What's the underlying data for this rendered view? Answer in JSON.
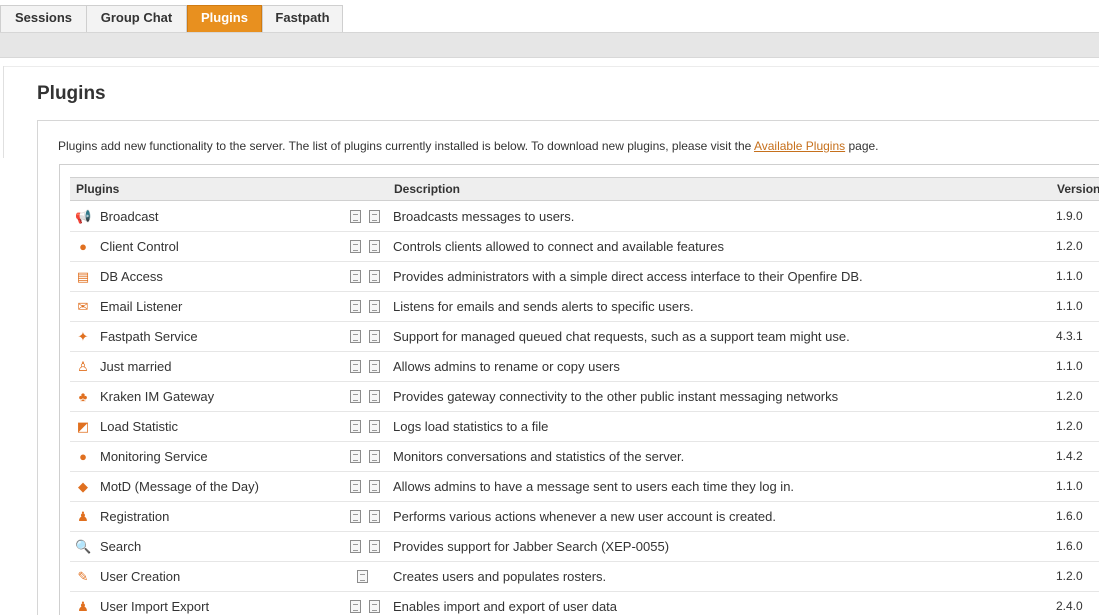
{
  "tabs": [
    {
      "label": "Sessions",
      "active": false
    },
    {
      "label": "Group Chat",
      "active": false
    },
    {
      "label": "Plugins",
      "active": true
    },
    {
      "label": "Fastpath",
      "active": false
    }
  ],
  "page": {
    "title": "Plugins",
    "intro_before": "Plugins add new functionality to the server. The list of plugins currently installed is below. To download new plugins, please visit the ",
    "intro_link": "Available Plugins",
    "intro_after": " page."
  },
  "table": {
    "headers": {
      "plugins": "Plugins",
      "description": "Description",
      "version": "Version"
    },
    "rows": [
      {
        "name": "Broadcast",
        "icon": "megaphone-icon",
        "glyph": "📢",
        "description": "Broadcasts messages to users.",
        "version": "1.9.0",
        "docs": 2
      },
      {
        "name": "Client Control",
        "icon": "client-control-icon",
        "glyph": "●",
        "description": "Controls clients allowed to connect and available features",
        "version": "1.2.0",
        "docs": 2
      },
      {
        "name": "DB Access",
        "icon": "database-window-icon",
        "glyph": "▤",
        "description": "Provides administrators with a simple direct access interface to their Openfire DB.",
        "version": "1.1.0",
        "docs": 2
      },
      {
        "name": "Email Listener",
        "icon": "email-icon",
        "glyph": "✉",
        "description": "Listens for emails and sends alerts to specific users.",
        "version": "1.1.0",
        "docs": 2
      },
      {
        "name": "Fastpath Service",
        "icon": "fastpath-flame-icon",
        "glyph": "✦",
        "description": "Support for managed queued chat requests, such as a support team might use.",
        "version": "4.3.1",
        "docs": 2
      },
      {
        "name": "Just married",
        "icon": "couple-icon",
        "glyph": "♙",
        "description": "Allows admins to rename or copy users",
        "version": "1.1.0",
        "docs": 2
      },
      {
        "name": "Kraken IM Gateway",
        "icon": "kraken-icon",
        "glyph": "♣",
        "description": "Provides gateway connectivity to the other public instant messaging networks",
        "version": "1.2.0",
        "docs": 2
      },
      {
        "name": "Load Statistic",
        "icon": "chart-icon",
        "glyph": "◩",
        "description": "Logs load statistics to a file",
        "version": "1.2.0",
        "docs": 2
      },
      {
        "name": "Monitoring Service",
        "icon": "monitoring-icon",
        "glyph": "●",
        "description": "Monitors conversations and statistics of the server.",
        "version": "1.4.2",
        "docs": 2
      },
      {
        "name": "MotD (Message of the Day)",
        "icon": "message-icon",
        "glyph": "◆",
        "description": "Allows admins to have a message sent to users each time they log in.",
        "version": "1.1.0",
        "docs": 2
      },
      {
        "name": "Registration",
        "icon": "user-add-icon",
        "glyph": "♟",
        "description": "Performs various actions whenever a new user account is created.",
        "version": "1.6.0",
        "docs": 2
      },
      {
        "name": "Search",
        "icon": "search-icon",
        "glyph": "🔍",
        "description": "Provides support for Jabber Search (XEP-0055)",
        "version": "1.6.0",
        "docs": 2
      },
      {
        "name": "User Creation",
        "icon": "user-creation-icon",
        "glyph": "✎",
        "description": "Creates users and populates rosters.",
        "version": "1.2.0",
        "docs": 1
      },
      {
        "name": "User Import Export",
        "icon": "user-import-export-icon",
        "glyph": "♟",
        "description": "Enables import and export of user data",
        "version": "2.4.0",
        "docs": 2
      }
    ]
  },
  "colors": {
    "accent": "#e8901f",
    "link": "#c6701c"
  }
}
